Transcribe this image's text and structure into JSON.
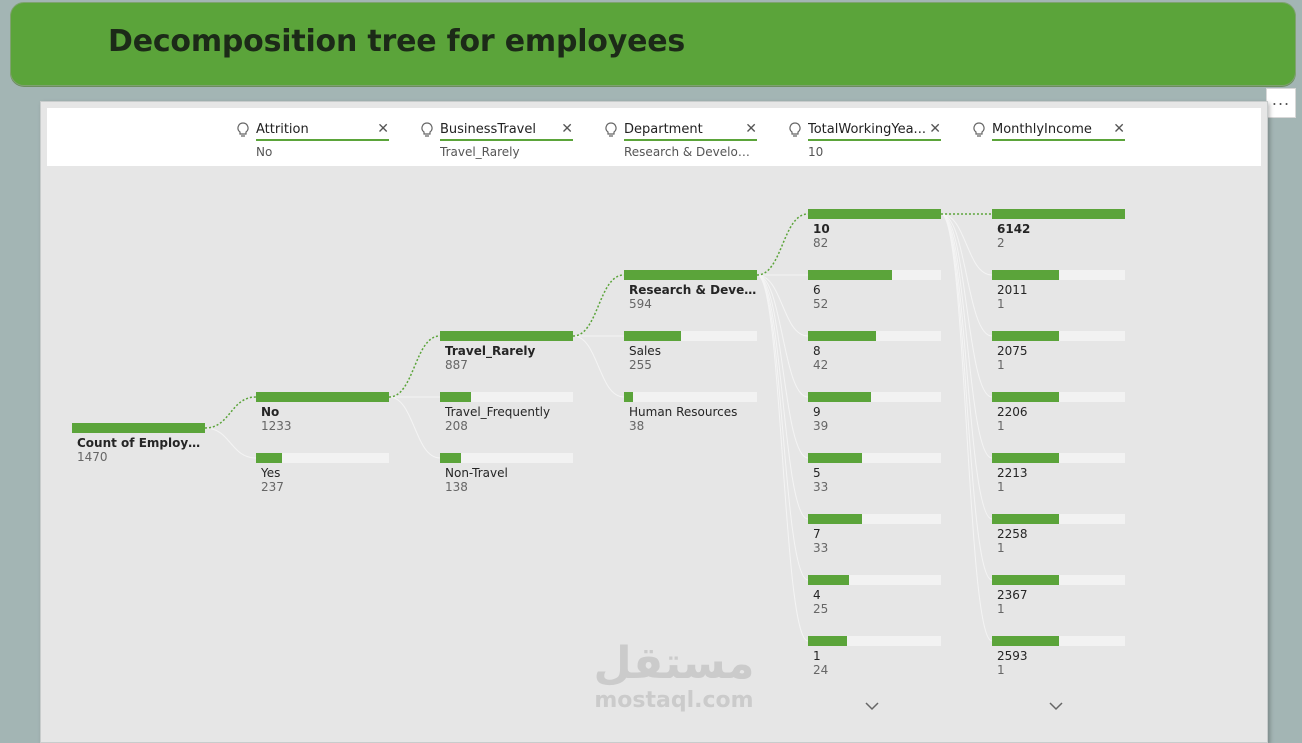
{
  "title": "Decomposition tree for employees",
  "more_options": "...",
  "colors": {
    "accent": "#5ba43a",
    "track": "#f2f2f2"
  },
  "levels": [
    {
      "name": "Attrition",
      "value": "No"
    },
    {
      "name": "BusinessTravel",
      "value": "Travel_Rarely"
    },
    {
      "name": "Department",
      "value": "Research & Developm..."
    },
    {
      "name": "TotalWorkingYea...",
      "value": "10"
    },
    {
      "name": "MonthlyIncome",
      "value": ""
    }
  ],
  "root": {
    "label": "Count of EmployeeN...",
    "count": "1470",
    "value": 1470
  },
  "columns": [
    {
      "nodes": [
        {
          "label": "No",
          "count": "1233",
          "value": 1233,
          "selected": true
        },
        {
          "label": "Yes",
          "count": "237",
          "value": 237,
          "selected": false
        }
      ]
    },
    {
      "nodes": [
        {
          "label": "Travel_Rarely",
          "count": "887",
          "value": 887,
          "selected": true
        },
        {
          "label": "Travel_Frequently",
          "count": "208",
          "value": 208,
          "selected": false
        },
        {
          "label": "Non-Travel",
          "count": "138",
          "value": 138,
          "selected": false
        }
      ]
    },
    {
      "nodes": [
        {
          "label": "Research & Develop...",
          "count": "594",
          "value": 594,
          "selected": true
        },
        {
          "label": "Sales",
          "count": "255",
          "value": 255,
          "selected": false
        },
        {
          "label": "Human Resources",
          "count": "38",
          "value": 38,
          "selected": false
        }
      ]
    },
    {
      "nodes": [
        {
          "label": "10",
          "count": "82",
          "value": 82,
          "selected": true
        },
        {
          "label": "6",
          "count": "52",
          "value": 52,
          "selected": false
        },
        {
          "label": "8",
          "count": "42",
          "value": 42,
          "selected": false
        },
        {
          "label": "9",
          "count": "39",
          "value": 39,
          "selected": false
        },
        {
          "label": "5",
          "count": "33",
          "value": 33,
          "selected": false
        },
        {
          "label": "7",
          "count": "33",
          "value": 33,
          "selected": false
        },
        {
          "label": "4",
          "count": "25",
          "value": 25,
          "selected": false
        },
        {
          "label": "1",
          "count": "24",
          "value": 24,
          "selected": false
        }
      ],
      "has_more": true
    },
    {
      "nodes": [
        {
          "label": "6142",
          "count": "2",
          "value": 2,
          "selected": true
        },
        {
          "label": "2011",
          "count": "1",
          "value": 1,
          "selected": false
        },
        {
          "label": "2075",
          "count": "1",
          "value": 1,
          "selected": false
        },
        {
          "label": "2206",
          "count": "1",
          "value": 1,
          "selected": false
        },
        {
          "label": "2213",
          "count": "1",
          "value": 1,
          "selected": false
        },
        {
          "label": "2258",
          "count": "1",
          "value": 1,
          "selected": false
        },
        {
          "label": "2367",
          "count": "1",
          "value": 1,
          "selected": false
        },
        {
          "label": "2593",
          "count": "1",
          "value": 1,
          "selected": false
        }
      ],
      "has_more": true
    }
  ],
  "watermark": {
    "arabic": "مستقل",
    "latin": "mostaql.com"
  }
}
